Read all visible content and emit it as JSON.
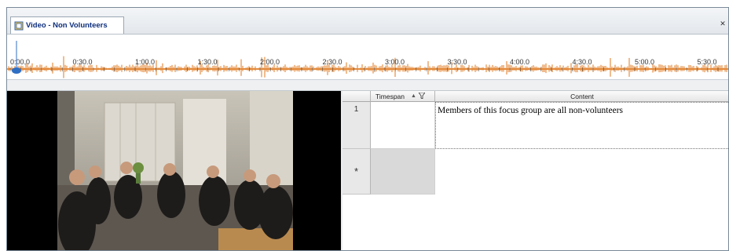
{
  "tab": {
    "title": "Video - Non Volunteers",
    "icon": "film-icon"
  },
  "timeline": {
    "labels": [
      "0:00.0",
      "0:30.0",
      "1:00.0",
      "1:30.0",
      "2:00.0",
      "2:30.0",
      "3:00.0",
      "3:30.0",
      "4:00.0",
      "4:30.0",
      "5:00.0",
      "5:30.0"
    ],
    "waveform_color": "#e07a1f",
    "cursor_color": "#2f6fc4"
  },
  "grid": {
    "columns": {
      "timespan": "Timespan",
      "content": "Content"
    },
    "rows": [
      {
        "number": "1",
        "timespan": "",
        "content": "Members of this focus group are all non-volunteers"
      }
    ],
    "new_row_marker": "*"
  }
}
